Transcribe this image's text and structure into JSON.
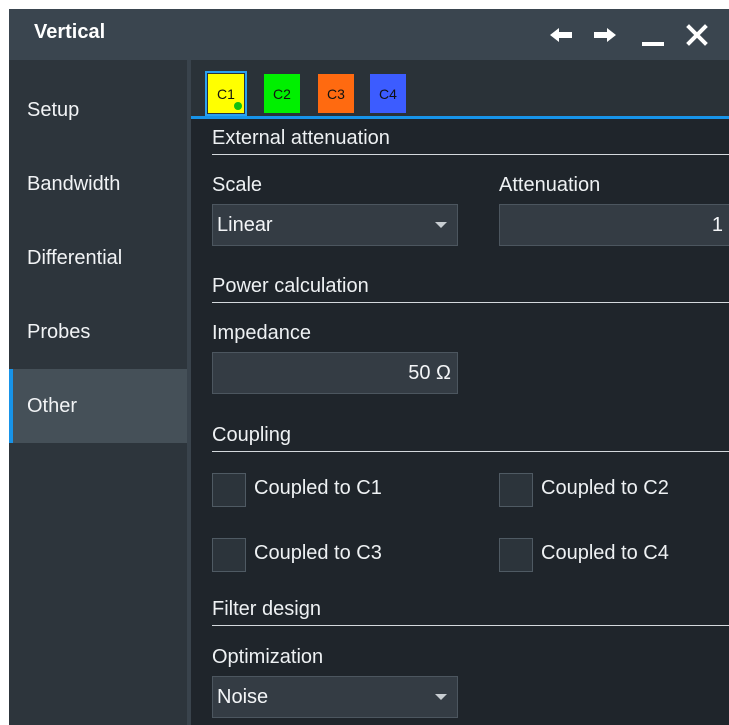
{
  "window": {
    "title": "Vertical",
    "controls": [
      {
        "name": "back-arrow-icon",
        "glyph": "left-arrow"
      },
      {
        "name": "forward-arrow-icon",
        "glyph": "right-arrow"
      },
      {
        "name": "minimize-icon",
        "glyph": "underscore"
      },
      {
        "name": "close-icon",
        "glyph": "x"
      }
    ]
  },
  "sidebar": {
    "items": [
      {
        "label": "Setup",
        "active": false
      },
      {
        "label": "Bandwidth",
        "active": false
      },
      {
        "label": "Differential",
        "active": false
      },
      {
        "label": "Probes",
        "active": false
      },
      {
        "label": "Other",
        "active": true
      }
    ],
    "accent_color": "#1793e8"
  },
  "tabs": [
    {
      "label": "C1",
      "color": "#ffff00",
      "selected": true
    },
    {
      "label": "C2",
      "color": "#00f000",
      "selected": false
    },
    {
      "label": "C3",
      "color": "#ff6a10",
      "selected": false
    },
    {
      "label": "C4",
      "color": "#3c5cff",
      "selected": false
    }
  ],
  "external_attenuation": {
    "heading": "External attenuation",
    "scale_label": "Scale",
    "scale_value": "Linear",
    "attenuation_label": "Attenuation",
    "attenuation_value": "1"
  },
  "power_calculation": {
    "heading": "Power calculation",
    "impedance_label": "Impedance",
    "impedance_value": "50 Ω"
  },
  "coupling": {
    "heading": "Coupling",
    "options": [
      {
        "label": "Coupled to C1",
        "checked": false
      },
      {
        "label": "Coupled to C2",
        "checked": false
      },
      {
        "label": "Coupled to C3",
        "checked": false
      },
      {
        "label": "Coupled to C4",
        "checked": false
      }
    ]
  },
  "filter_design": {
    "heading": "Filter design",
    "optimization_label": "Optimization",
    "optimization_value": "Noise"
  }
}
